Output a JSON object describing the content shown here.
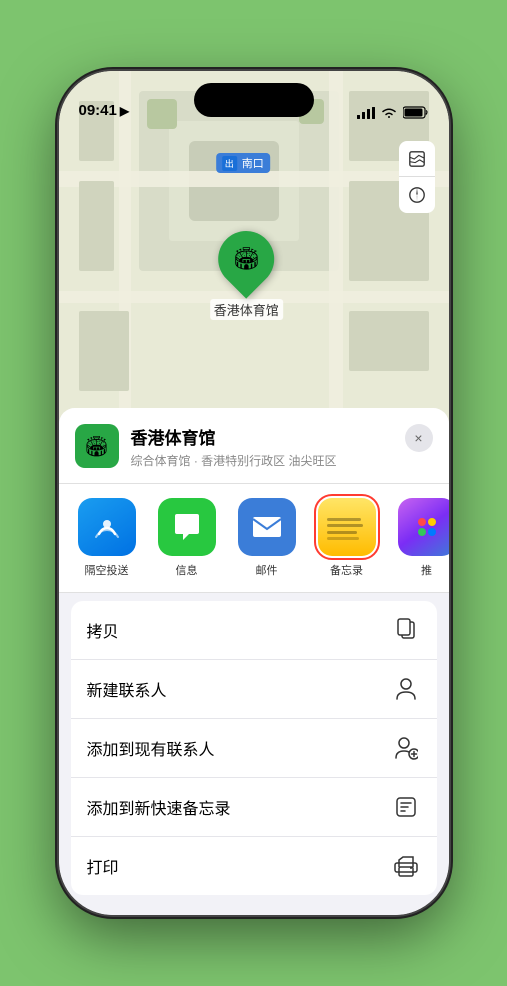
{
  "status_bar": {
    "time": "09:41",
    "location_arrow": "▶"
  },
  "map": {
    "location_tag": "南口",
    "location_tag_prefix": "출구"
  },
  "venue": {
    "name": "香港体育馆",
    "description": "综合体育馆 · 香港特别行政区 油尖旺区",
    "close_label": "×"
  },
  "share_items": [
    {
      "id": "airdrop",
      "label": "隔空投送",
      "type": "airdrop"
    },
    {
      "id": "messages",
      "label": "信息",
      "type": "messages"
    },
    {
      "id": "mail",
      "label": "邮件",
      "type": "mail"
    },
    {
      "id": "notes",
      "label": "备忘录",
      "type": "notes"
    },
    {
      "id": "more",
      "label": "推",
      "type": "more"
    }
  ],
  "actions": [
    {
      "label": "拷贝",
      "icon": "copy"
    },
    {
      "label": "新建联系人",
      "icon": "person"
    },
    {
      "label": "添加到现有联系人",
      "icon": "person-add"
    },
    {
      "label": "添加到新快速备忘录",
      "icon": "note"
    },
    {
      "label": "打印",
      "icon": "printer"
    }
  ],
  "pin_label": "香港体育馆"
}
